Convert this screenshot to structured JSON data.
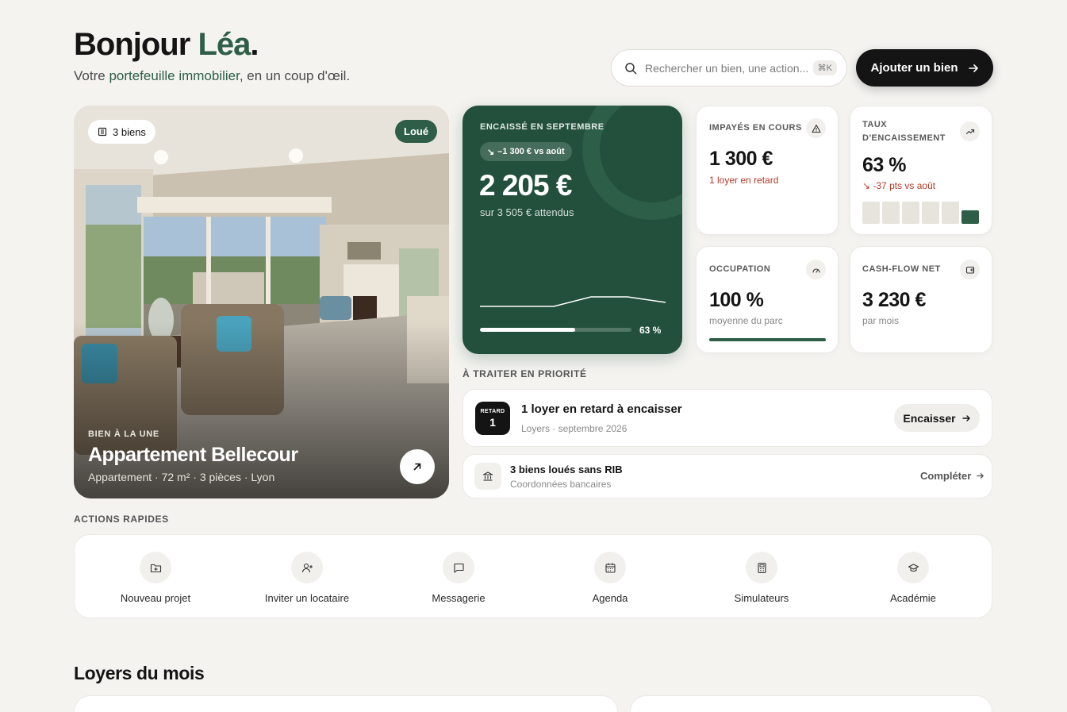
{
  "header": {
    "greeting_prefix": "Bonjour",
    "greeting_name": "Léa",
    "greeting_suffix": ".",
    "subtitle_prefix": "Votre",
    "subtitle_highlight": "portefeuille immobilier",
    "subtitle_suffix": ", en un coup d'œil.",
    "search_placeholder": "Rechercher un bien, une action...",
    "search_shortcut": "⌘K",
    "add_button_label": "Ajouter un bien",
    "icons": {
      "search": "search-icon",
      "add_arrow": "arrow-right-icon"
    }
  },
  "featured": {
    "count_label": "3 biens",
    "status_label": "Loué",
    "eyebrow": "BIEN À LA UNE",
    "title": "Appartement Bellecour",
    "details": "Appartement · 72 m² · 3 pièces · Lyon",
    "icons": {
      "count": "building-icon",
      "open": "arrow-up-right-icon"
    }
  },
  "collected": {
    "label": "ENCAISSÉ EN SEPTEMBRE",
    "delta_label": "–1 300 € vs août",
    "value": "2 205 €",
    "subtitle": "sur 3 505 € attendus",
    "progress_label": "63 %",
    "progress_fraction": 0.63,
    "accent": "#23503c"
  },
  "kpis": {
    "unpaid": {
      "label": "IMPAYÉS EN COURS",
      "value": "1 300 €",
      "sub": "1 loyer en retard",
      "icon": "alert-triangle-icon"
    },
    "rate": {
      "label_line1": "TAUX",
      "label_line2": "D'ENCAISSEMENT",
      "value": "63 %",
      "sub": "↘ -37 pts vs août",
      "icon": "trending-up-icon"
    },
    "occupancy": {
      "label": "OCCUPATION",
      "value": "100 %",
      "sub": "moyenne du parc",
      "icon": "gauge-icon",
      "fraction": 1.0
    },
    "cashflow": {
      "label": "CASH-FLOW NET",
      "value": "3 230 €",
      "sub": "par mois",
      "icon": "wallet-icon"
    }
  },
  "priority": {
    "section_label": "À TRAITER EN PRIORITÉ",
    "late": {
      "badge_label": "RETARD",
      "badge_count": "1",
      "title": "1 loyer en retard à encaisser",
      "sub": "Loyers · septembre 2026",
      "action": "Encaisser"
    },
    "rib": {
      "title": "3 biens loués sans RIB",
      "sub": "Coordonnées bancaires",
      "action": "Compléter",
      "icon": "bank-icon"
    }
  },
  "quick_actions": {
    "section_label": "ACTIONS RAPIDES",
    "items": [
      {
        "label": "Nouveau projet",
        "icon": "folder-plus-icon"
      },
      {
        "label": "Inviter un locataire",
        "icon": "user-plus-icon"
      },
      {
        "label": "Messagerie",
        "icon": "message-icon"
      },
      {
        "label": "Agenda",
        "icon": "calendar-icon"
      },
      {
        "label": "Simulateurs",
        "icon": "calculator-icon"
      },
      {
        "label": "Académie",
        "icon": "graduation-cap-icon"
      }
    ]
  },
  "rents": {
    "title": "Loyers du mois"
  }
}
